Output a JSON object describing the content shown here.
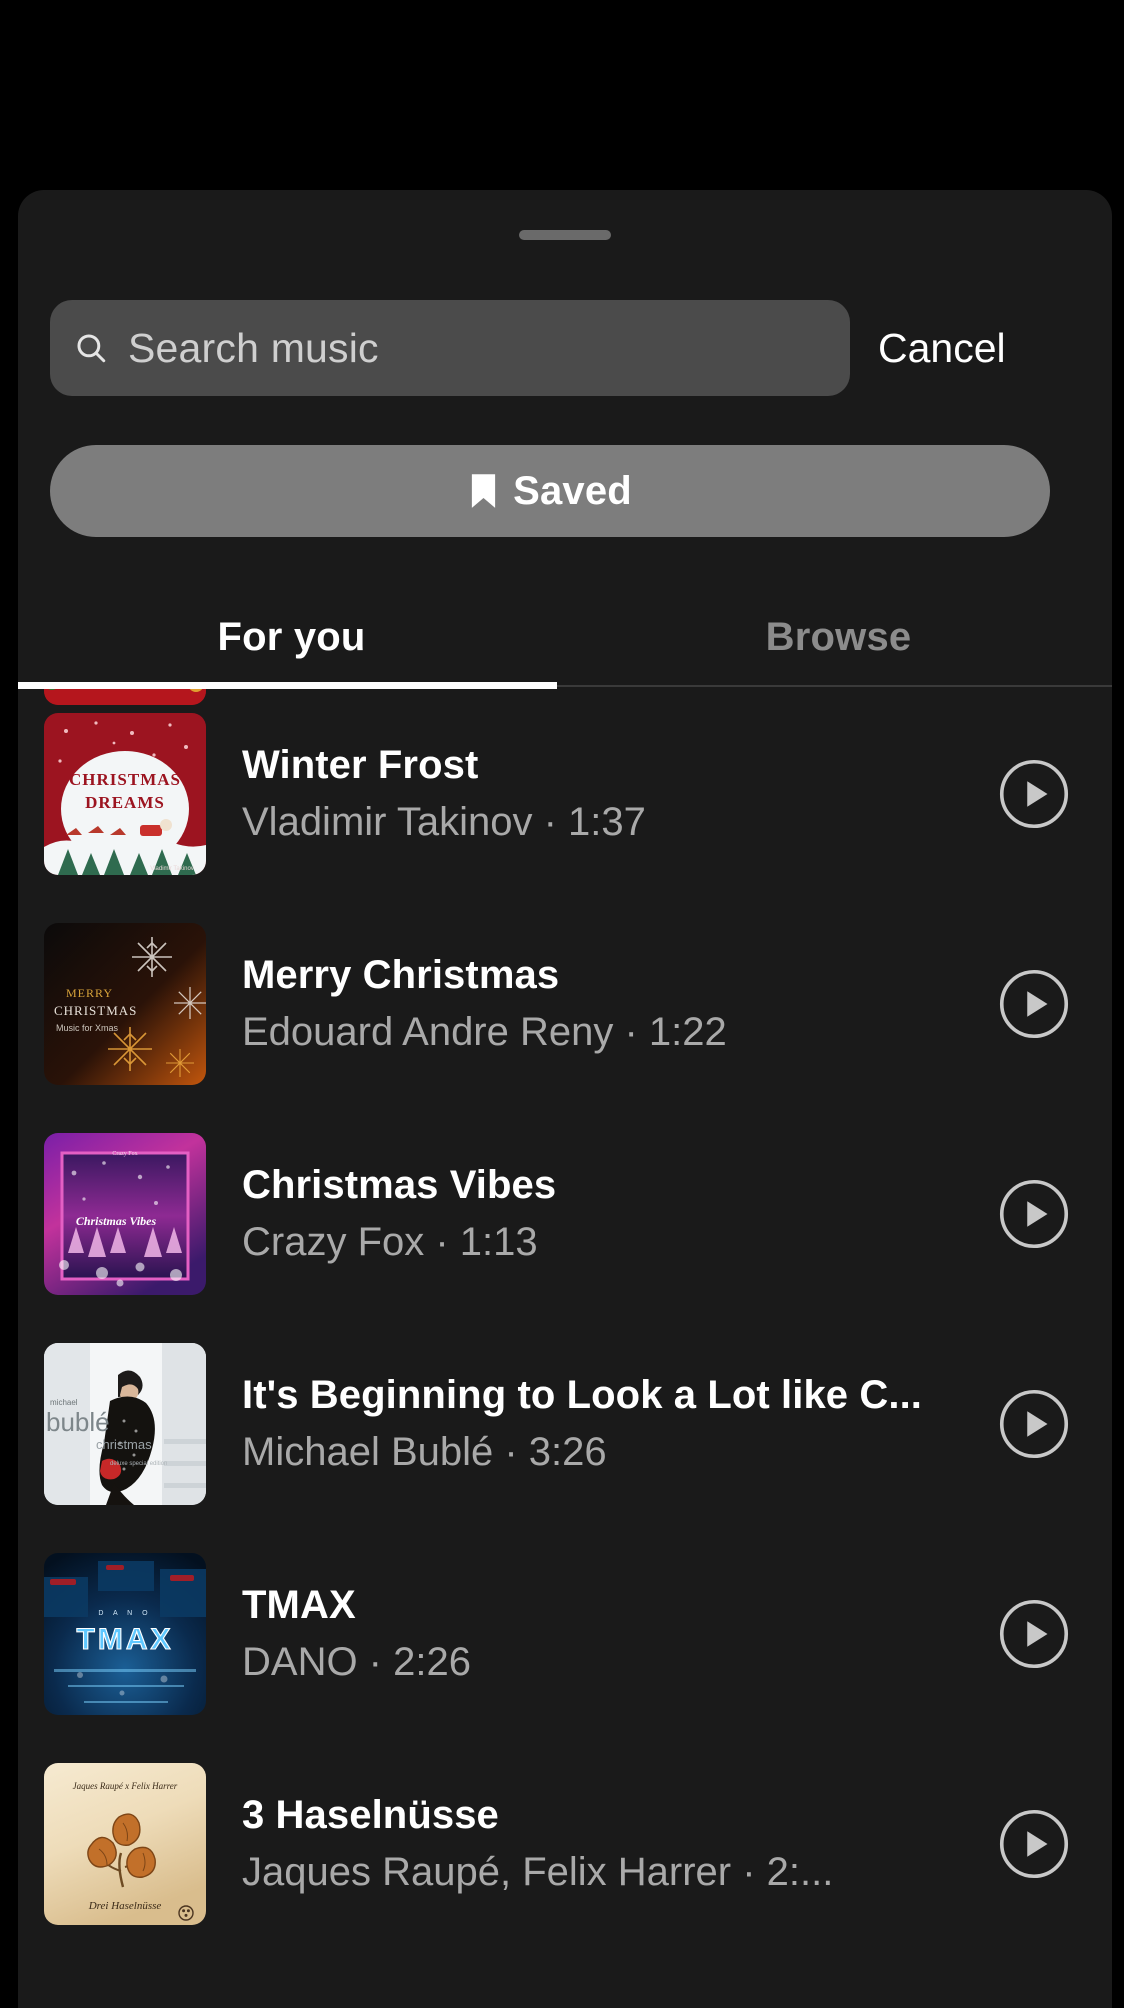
{
  "sheet": {
    "drag_handle": "drag-handle",
    "search": {
      "placeholder": "Search music",
      "value": "",
      "icon": "search-icon"
    },
    "cancel_label": "Cancel",
    "saved_button": {
      "label": "Saved",
      "icon": "bookmark-icon"
    },
    "tabs": [
      {
        "label": "For you",
        "active": true
      },
      {
        "label": "Browse",
        "active": false
      }
    ]
  },
  "tracks": [
    {
      "title": "Winter Frost",
      "meta": "Vladimir Takinov · 1:37",
      "artist": "Vladimir Takinov",
      "duration": "1:37",
      "art_name": "christmas-dreams-cover",
      "play_icon": "play-icon"
    },
    {
      "title": "Merry Christmas",
      "meta": "Edouard Andre Reny · 1:22",
      "artist": "Edouard Andre Reny",
      "duration": "1:22",
      "art_name": "merry-christmas-cover",
      "play_icon": "play-icon"
    },
    {
      "title": "Christmas Vibes",
      "meta": "Crazy Fox · 1:13",
      "artist": "Crazy Fox",
      "duration": "1:13",
      "art_name": "christmas-vibes-cover",
      "play_icon": "play-icon"
    },
    {
      "title": "It's Beginning to Look a Lot like C...",
      "meta": "Michael Bublé · 3:26",
      "artist": "Michael Bublé",
      "duration": "3:26",
      "art_name": "michael-buble-christmas-cover",
      "play_icon": "play-icon"
    },
    {
      "title": "TMAX",
      "meta": "DANO · 2:26",
      "artist": "DANO",
      "duration": "2:26",
      "art_name": "tmax-cover",
      "play_icon": "play-icon"
    },
    {
      "title": "3 Haselnüsse",
      "meta": "Jaques Raupé, Felix Harrer · 2:...",
      "artist": "Jaques Raupé, Felix Harrer",
      "duration": "2:...",
      "art_name": "drei-haselnuesse-cover",
      "play_icon": "play-icon"
    }
  ],
  "colors": {
    "background": "#000000",
    "sheet": "#1a1a1a",
    "search_field": "#4b4b4b",
    "saved_pill": "#7d7d7d",
    "text_primary": "#ffffff",
    "text_secondary": "#a9a9a9",
    "tab_inactive": "#8c8c8c",
    "tab_indicator": "#ffffff"
  }
}
